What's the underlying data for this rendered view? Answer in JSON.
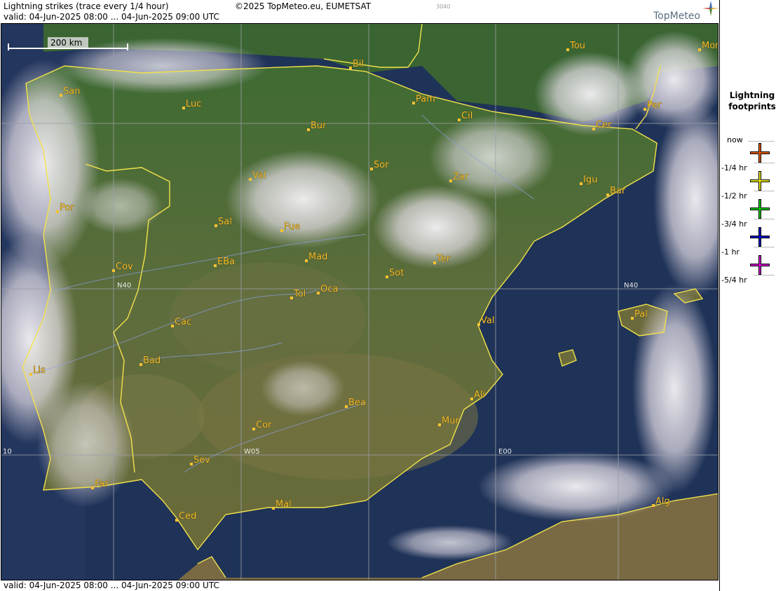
{
  "header": {
    "title": "Lightning strikes (trace every 1/4 hour)",
    "copyright": "©2025 TopMeteo.eu, EUMETSAT",
    "code": "3040",
    "valid": "valid:  04-Jun-2025 08:00 ... 04-Jun-2025 09:00 UTC",
    "logo": "TopMeteo"
  },
  "footer": {
    "valid": "valid:  04-Jun-2025 08:00 ... 04-Jun-2025 09:00 UTC"
  },
  "map": {
    "scale_label": "200 km",
    "gridlines": {
      "lat_label": "N40",
      "lon_labels": [
        "10",
        "W05",
        "E00"
      ]
    },
    "cities": [
      {
        "name": "Tou"
      },
      {
        "name": "Mon"
      },
      {
        "name": "Bil"
      },
      {
        "name": "San"
      },
      {
        "name": "Pam"
      },
      {
        "name": "Luc"
      },
      {
        "name": "Cil"
      },
      {
        "name": "Per"
      },
      {
        "name": "Bur"
      },
      {
        "name": "Cer"
      },
      {
        "name": "Sor"
      },
      {
        "name": "Val"
      },
      {
        "name": "Zar"
      },
      {
        "name": "Igu"
      },
      {
        "name": "Bar"
      },
      {
        "name": "Por"
      },
      {
        "name": "Sal"
      },
      {
        "name": "Fue"
      },
      {
        "name": "Mad"
      },
      {
        "name": "Cov"
      },
      {
        "name": "EBa"
      },
      {
        "name": "Ter"
      },
      {
        "name": "Sot"
      },
      {
        "name": "Tol"
      },
      {
        "name": "Oca"
      },
      {
        "name": "Pal"
      },
      {
        "name": "Cac"
      },
      {
        "name": "Val"
      },
      {
        "name": "Bad"
      },
      {
        "name": "Lis"
      },
      {
        "name": "Ali"
      },
      {
        "name": "Bea"
      },
      {
        "name": "Mur"
      },
      {
        "name": "Cor"
      },
      {
        "name": "Sev"
      },
      {
        "name": "Far"
      },
      {
        "name": "Alg"
      },
      {
        "name": "Mal"
      },
      {
        "name": "Ced"
      }
    ]
  },
  "legend": {
    "title_line1": "Lightning",
    "title_line2": "footprints",
    "items": [
      {
        "label": "now",
        "color": "#e05a10"
      },
      {
        "label": "-1/4 hr",
        "color": "#e6e600"
      },
      {
        "label": "-1/2 hr",
        "color": "#00cc00"
      },
      {
        "label": "-3/4 hr",
        "color": "#0000cc"
      },
      {
        "label": "-1 hr",
        "color": "#cc00cc"
      },
      {
        "label": "-5/4 hr",
        "color": ""
      }
    ]
  }
}
